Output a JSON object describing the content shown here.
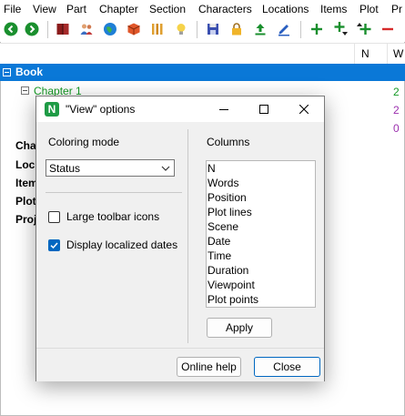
{
  "menu": [
    "File",
    "View",
    "Part",
    "Chapter",
    "Section",
    "Characters",
    "Locations",
    "Items",
    "Plot",
    "Pr"
  ],
  "toolbar": {
    "icons": [
      "back-icon",
      "forward-icon",
      "book-icon",
      "characters-icon",
      "locations-icon",
      "items-icon",
      "plot-lines-icon",
      "idea-icon",
      "save-icon",
      "lock-icon",
      "export-icon",
      "edit-icon",
      "add-icon",
      "add-child-icon",
      "add-sibling-icon",
      "remove-icon"
    ],
    "colors": {
      "green": "#1a8f2e",
      "red": "#d62b2b",
      "maroon": "#8b1c1c"
    }
  },
  "tree": {
    "columns": [
      "N",
      "W"
    ],
    "book_label": "Book",
    "chapter_label": "Chapter 1",
    "right_values": [
      "2",
      "2",
      "0"
    ],
    "right_value_colors": [
      "#159a25",
      "#9b2fae",
      "#9b2fae"
    ],
    "background_labels": [
      "Cha",
      "Loc",
      "Item",
      "Plot",
      "Proj"
    ]
  },
  "dialog": {
    "title": "\"View\" options",
    "coloring_mode_label": "Coloring mode",
    "coloring_mode_value": "Status",
    "large_icons_label": "Large toolbar icons",
    "large_icons_checked": false,
    "localized_dates_label": "Display localized dates",
    "localized_dates_checked": true,
    "columns_label": "Columns",
    "columns": [
      "N",
      "Words",
      "Position",
      "Plot lines",
      "Scene",
      "Date",
      "Time",
      "Duration",
      "Viewpoint",
      "Plot points"
    ],
    "apply_label": "Apply",
    "online_help_label": "Online help",
    "close_label": "Close"
  }
}
